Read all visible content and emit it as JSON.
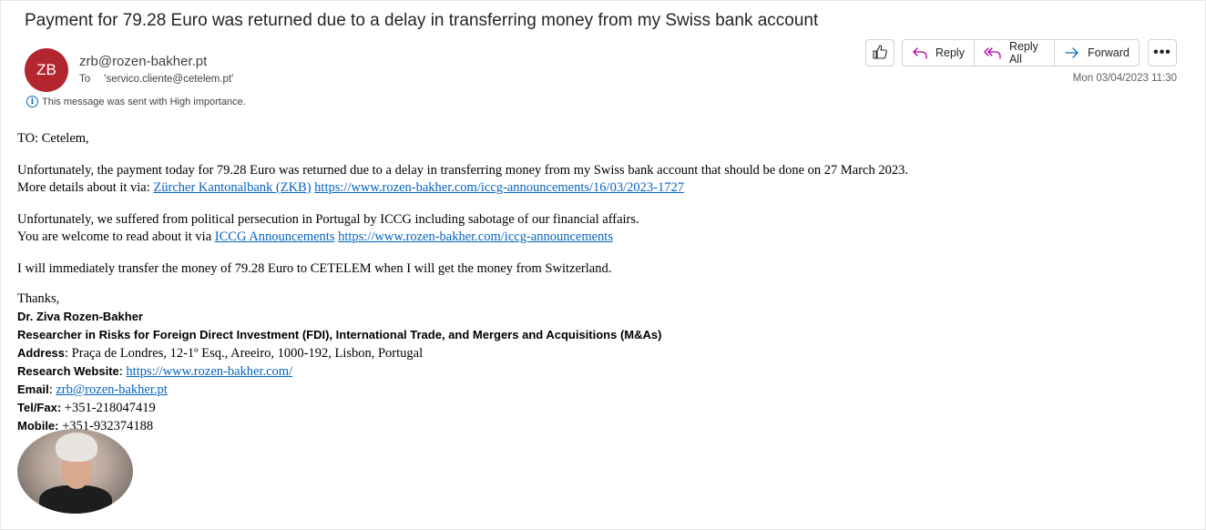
{
  "message": {
    "subject": "Payment for 79.28 Euro was returned due to a delay in transferring money from my Swiss bank account",
    "sender_initials": "ZB",
    "sender_email": "zrb@rozen-bakher.pt",
    "to_label": "To",
    "recipient": "'servico.cliente@cetelem.pt'",
    "importance_note": "This message was sent with High importance.",
    "date": "Mon 03/04/2023 11:30",
    "avatar_color": "#b3262f"
  },
  "toolbar": {
    "reply_label": "Reply",
    "reply_all_label": "Reply All",
    "forward_label": "Forward",
    "more_label": "•••"
  },
  "body": {
    "greeting": "TO: Cetelem,",
    "p1_line1": "Unfortunately, the payment today for 79.28 Euro was returned due to a delay in transferring money from my Swiss bank account that should be done on 27 March 2023.",
    "p1_line2_prefix": "More details about it via: ",
    "p1_link1": "Zürcher Kantonalbank (ZKB)",
    "p1_link2": "https://www.rozen-bakher.com/iccg-announcements/16/03/2023-1727",
    "p2_line1": "Unfortunately, we suffered from political persecution in Portugal by ICCG including sabotage of our financial affairs.",
    "p2_line2_prefix": "You are welcome to read about it via ",
    "p2_link1": "ICCG Announcements",
    "p2_link2": "https://www.rozen-bakher.com/iccg-announcements",
    "p3": "I will immediately transfer the money of 79.28 Euro to CETELEM when I will get the money from Switzerland.",
    "thanks": "Thanks,"
  },
  "signature": {
    "name": "Dr. Ziva Rozen-Bakher",
    "title": "Researcher in Risks for Foreign Direct Investment (FDI), International Trade, and Mergers and Acquisitions (M&As)",
    "address_label": "Address",
    "address_value": ": Praça de Londres, 12-1º Esq., Areeiro, 1000-192, Lisbon, Portugal",
    "website_label": "Research Website",
    "website_sep": ": ",
    "website_value": "https://www.rozen-bakher.com/",
    "email_label": "Email",
    "email_sep": ": ",
    "email_value": "zrb@rozen-bakher.pt",
    "tel_label": "Tel/Fax:",
    "tel_value": " +351-218047419",
    "mobile_label": "Mobile:",
    "mobile_value": " +351-932374188"
  }
}
